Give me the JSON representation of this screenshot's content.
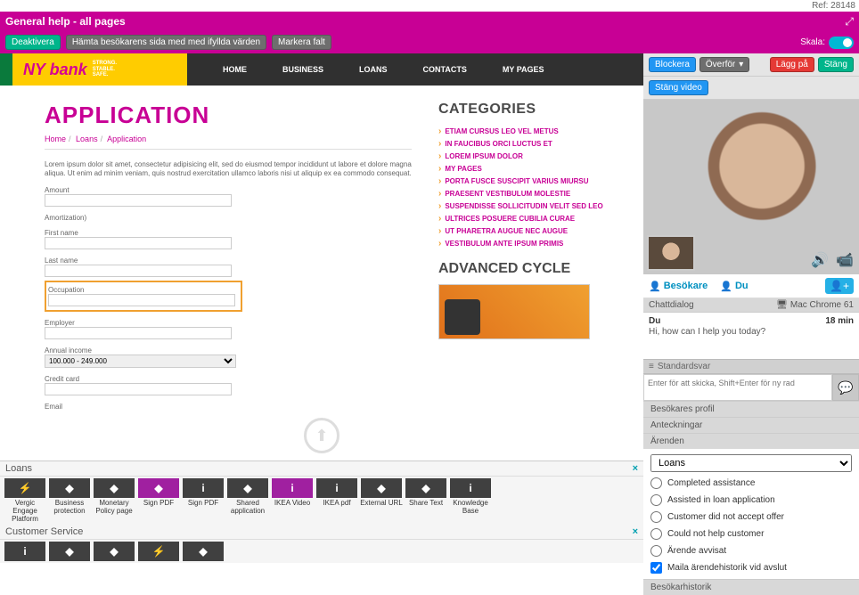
{
  "ref": "Ref: 28148",
  "general_help": "General help - all pages",
  "toolbar": {
    "deaktivera": "Deaktivera",
    "hamta": "Hämta besökarens sida med med ifyllda värden",
    "markera": "Markera falt",
    "skala": "Skala:",
    "blockera": "Blockera",
    "overfor": "Överför",
    "lagg_pa": "Lägg på",
    "stang": "Stäng",
    "stang_video": "Stäng video"
  },
  "bank": {
    "name": "NY bank",
    "tag1": "STRONG.",
    "tag2": "STABLE.",
    "tag3": "SAFE."
  },
  "nav": [
    "HOME",
    "BUSINESS",
    "LOANS",
    "CONTACTS",
    "MY PAGES"
  ],
  "page": {
    "title": "APPLICATION",
    "crumbs": [
      "Home",
      "Loans",
      "Application"
    ],
    "intro": "Lorem ipsum dolor sit amet, consectetur adipisicing elit, sed do eiusmod tempor incididunt ut labore et dolore magna aliqua. Ut enim ad minim veniam, quis nostrud exercitation ullamco laboris nisi ut aliquip ex ea commodo consequat.",
    "labels": {
      "amount": "Amount",
      "amortization": "Amortization)",
      "first_name": "First name",
      "last_name": "Last name",
      "occupation": "Occupation",
      "employer": "Employer",
      "annual_income": "Annual income",
      "income_value": "100.000 - 249.000",
      "credit_card": "Credit card",
      "email": "Email"
    }
  },
  "categories_title": "CATEGORIES",
  "categories": [
    "ETIAM CURSUS LEO VEL METUS",
    "IN FAUCIBUS ORCI LUCTUS ET",
    "LOREM IPSUM DOLOR",
    "MY PAGES",
    "PORTA FUSCE SUSCIPIT VARIUS MIURSU",
    "PRAESENT VESTIBULUM MOLESTIE",
    "SUSPENDISSE SOLLICITUDIN VELIT SED LEO",
    "ULTRICES POSUERE CUBILIA CURAE",
    "UT PHARETRA AUGUE NEC AUGUE",
    "VESTIBULUM ANTE IPSUM PRIMIS"
  ],
  "advanced_title": "ADVANCED CYCLE",
  "loans_section": "Loans",
  "tiles": [
    {
      "icon": "bolt",
      "label": "Vergic Engage Platform"
    },
    {
      "icon": "bookmark",
      "label": "Business protection"
    },
    {
      "icon": "bookmark",
      "label": "Monetary Policy page"
    },
    {
      "icon": "bookmark",
      "label": "Sign PDF",
      "accent": true
    },
    {
      "icon": "info",
      "label": "Sign PDF"
    },
    {
      "icon": "bookmark",
      "label": "Shared application"
    },
    {
      "icon": "info",
      "label": "IKEA Video",
      "accent": true
    },
    {
      "icon": "info",
      "label": "IKEA pdf"
    },
    {
      "icon": "bookmark",
      "label": "External URL"
    },
    {
      "icon": "bookmark",
      "label": "Share Text"
    },
    {
      "icon": "info",
      "label": "Knowledge Base"
    }
  ],
  "customer_service_section": "Customer Service",
  "side": {
    "besokare": "Besökare",
    "du": "Du",
    "chattdialog": "Chattdialog",
    "browser": "Mac Chrome 61",
    "chat_who": "Du",
    "chat_time": "18 min",
    "chat_msg": "Hi, how can I help you today?",
    "standardsvar": "Standardsvar",
    "input_placeholder": "Enter för att skicka, Shift+Enter för ny rad",
    "profile": "Besökares profil",
    "anteckningar": "Anteckningar",
    "arenden": "Ärenden",
    "case_select": "Loans",
    "case_options": [
      "Completed assistance",
      "Assisted in loan application",
      "Customer did not accept offer",
      "Could not help customer",
      "Ärende avvisat"
    ],
    "mail_check": "Maila ärendehistorik vid avslut",
    "historik": "Besökarhistorik"
  }
}
